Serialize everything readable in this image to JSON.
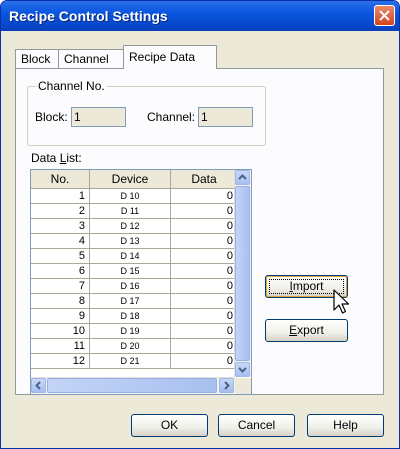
{
  "window": {
    "title": "Recipe Control Settings"
  },
  "tabs": [
    {
      "label": "Block"
    },
    {
      "label": "Channel"
    },
    {
      "label": "Recipe Data"
    }
  ],
  "channel_group": {
    "title": "Channel No.",
    "block_label": "Block:",
    "block_value": "1",
    "channel_label": "Channel:",
    "channel_value": "1"
  },
  "data_list": {
    "label_prefix": "Data ",
    "label_mnemonic": "L",
    "label_suffix": "ist:",
    "columns": [
      "No.",
      "Device",
      "Data"
    ],
    "rows": [
      [
        "1",
        "D 10",
        "0"
      ],
      [
        "2",
        "D 11",
        "0"
      ],
      [
        "3",
        "D 12",
        "0"
      ],
      [
        "4",
        "D 13",
        "0"
      ],
      [
        "5",
        "D 14",
        "0"
      ],
      [
        "6",
        "D 15",
        "0"
      ],
      [
        "7",
        "D 16",
        "0"
      ],
      [
        "8",
        "D 17",
        "0"
      ],
      [
        "9",
        "D 18",
        "0"
      ],
      [
        "10",
        "D 19",
        "0"
      ],
      [
        "11",
        "D 20",
        "0"
      ],
      [
        "12",
        "D 21",
        "0"
      ]
    ]
  },
  "side_buttons": {
    "import_mnemonic": "I",
    "import_rest": "mport",
    "export_mnemonic": "E",
    "export_rest": "xport"
  },
  "footer": {
    "ok": "OK",
    "cancel": "Cancel",
    "help": "Help"
  },
  "colors": {
    "title_bar": "#0a56e0",
    "close_button": "#d5441c",
    "dialog_bg": "#ece9d8",
    "panel_bg": "#fcfcfe"
  },
  "icons": [
    "close-icon",
    "scroll-up-icon",
    "scroll-down-icon",
    "scroll-left-icon",
    "scroll-right-icon",
    "mouse-pointer-icon"
  ]
}
